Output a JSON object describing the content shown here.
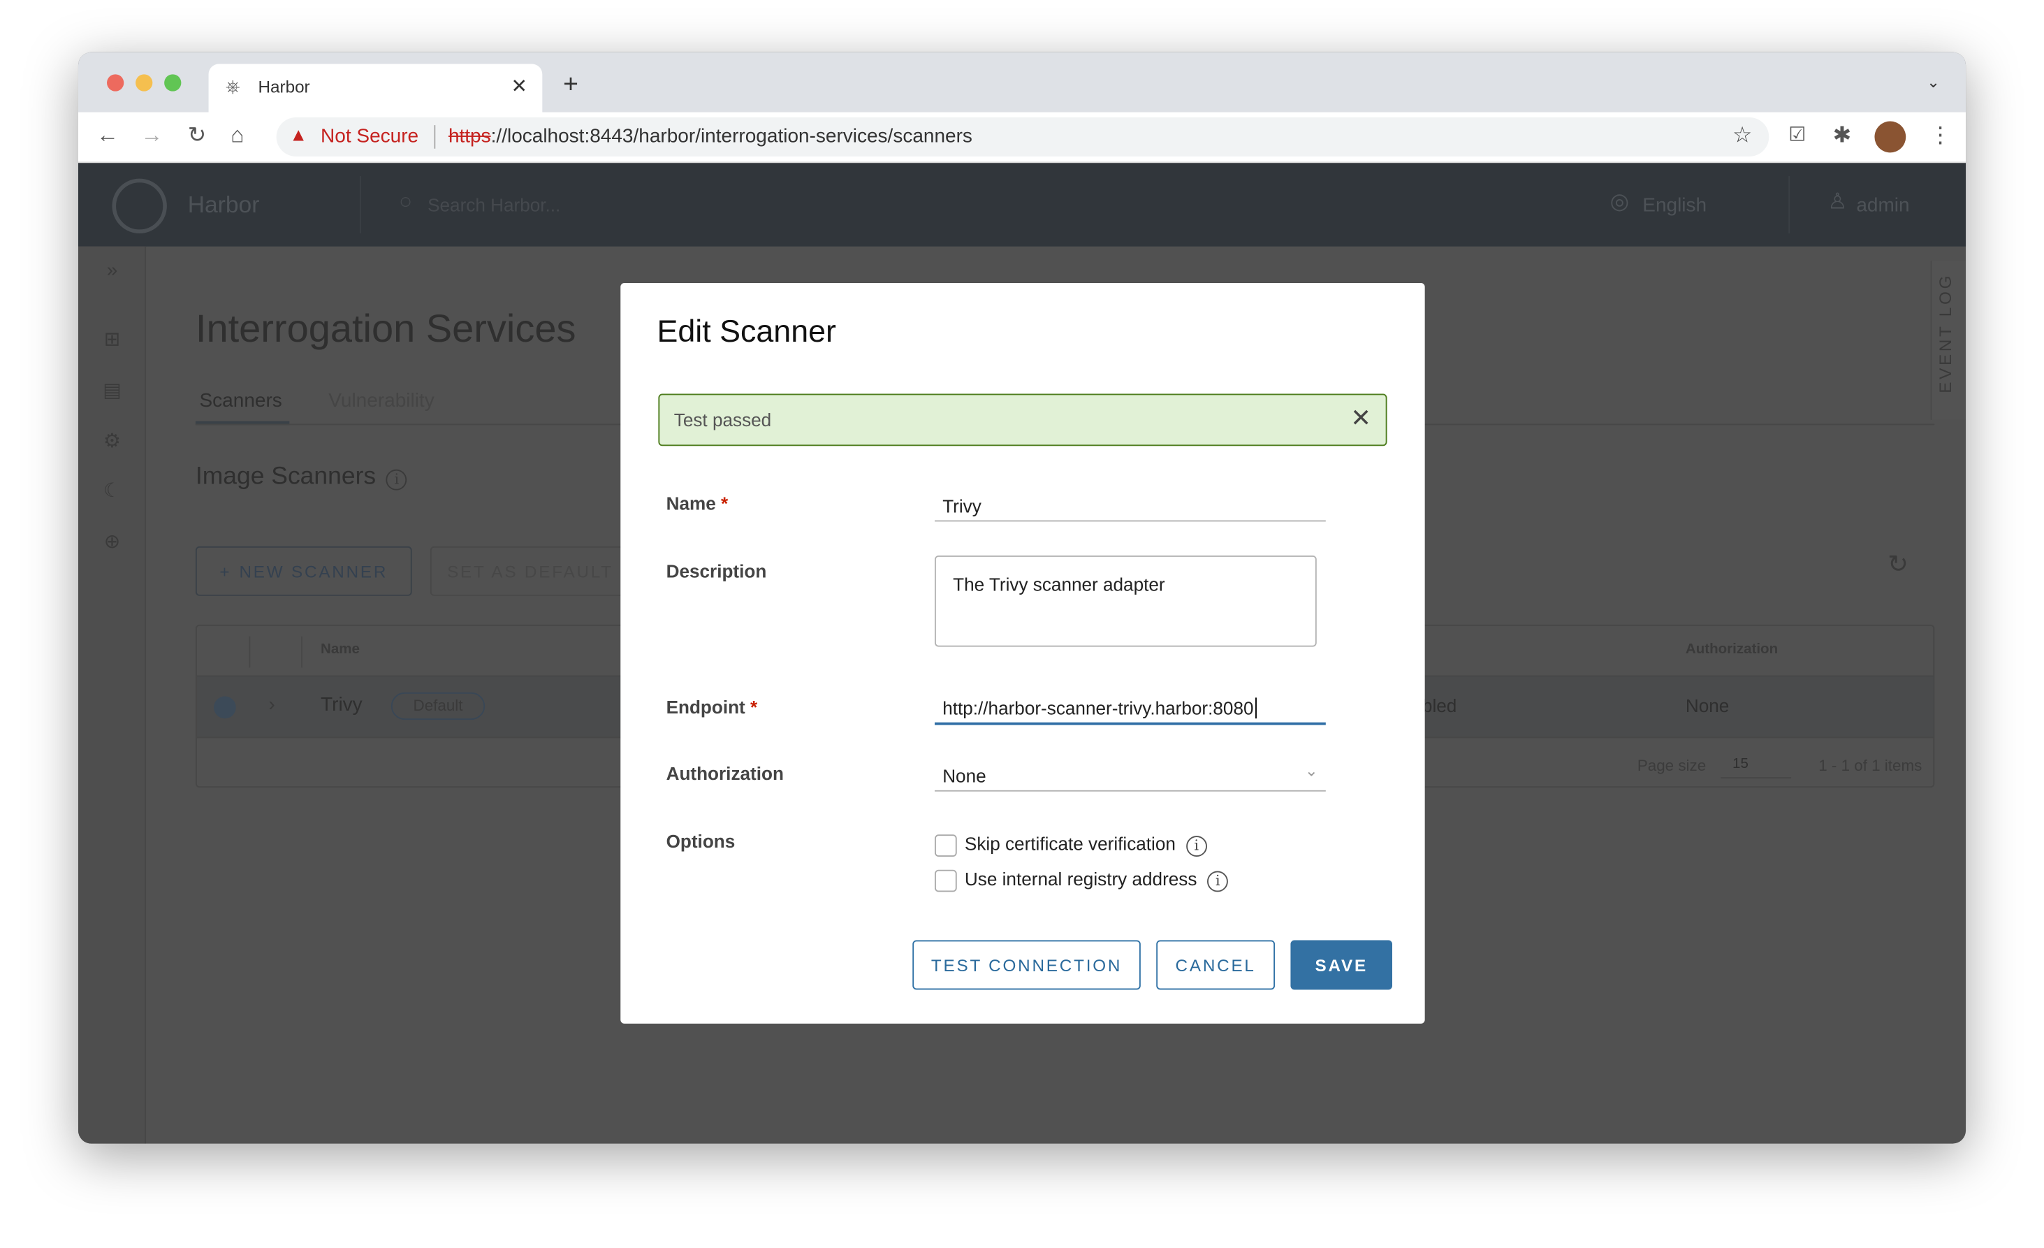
{
  "browser": {
    "tab_title": "Harbor",
    "url_warning": "Not Secure",
    "url_scheme": "https",
    "url_rest": "://localhost:8443/harbor/interrogation-services/scanners"
  },
  "header": {
    "app_name": "Harbor",
    "search_placeholder": "Search Harbor...",
    "language": "English",
    "user": "admin"
  },
  "page": {
    "title": "Interrogation Services",
    "tabs": [
      {
        "label": "Scanners"
      },
      {
        "label": "Vulnerability"
      }
    ],
    "section": "Image Scanners",
    "new_scanner": "NEW SCANNER",
    "set_default": "SET AS DEFAULT",
    "event_log": "EVENT LOG",
    "table": {
      "headers": {
        "name": "Name",
        "authorization": "Authorization"
      },
      "row": {
        "name": "Trivy",
        "badge": "Default",
        "status_partial": "bled",
        "authorization": "None"
      },
      "page_size_label": "Page size",
      "page_size": "15",
      "count": "1 - 1 of 1 items"
    }
  },
  "modal": {
    "title": "Edit Scanner",
    "alert": "Test passed",
    "name_label": "Name",
    "name_value": "Trivy",
    "description_label": "Description",
    "description_value": "The Trivy scanner adapter",
    "endpoint_label": "Endpoint",
    "endpoint_value": "http://harbor-scanner-trivy.harbor:8080",
    "authorization_label": "Authorization",
    "authorization_value": "None",
    "options_label": "Options",
    "skip_cert": "Skip certificate verification",
    "internal_registry": "Use internal registry address",
    "test_connection": "TEST CONNECTION",
    "cancel": "CANCEL",
    "save": "SAVE",
    "required_mark": "*"
  },
  "colors": {
    "primary": "#3371a3",
    "alert_bg": "#e1f1d6",
    "alert_border": "#4e7d1e",
    "required": "#c92100"
  }
}
